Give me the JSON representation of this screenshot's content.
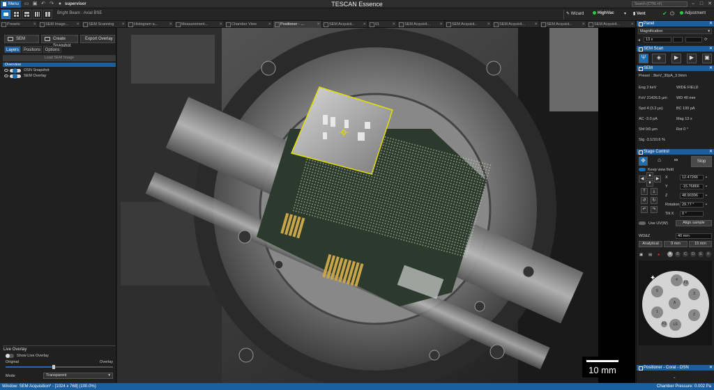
{
  "app": {
    "title": "TESCAN Essence",
    "menu_label": "Menu",
    "user": "supervisor",
    "beam": "Bright Beam : Axial BSE"
  },
  "toolbar": {
    "wizard": "Wizard",
    "vacuum": "HighVac",
    "vent": "Vent",
    "adjustment": "Adjustment",
    "search_placeholder": "Search (CTRL+F)"
  },
  "tabs": [
    {
      "label": "Presets",
      "active": false
    },
    {
      "label": "SEM Image...",
      "active": false
    },
    {
      "label": "SEM Scanning",
      "active": false
    },
    {
      "label": "Histogram a...",
      "active": false
    },
    {
      "label": "Measurement...",
      "active": false
    },
    {
      "label": "Chamber View",
      "active": false
    },
    {
      "label": "Positioner - ...",
      "active": true
    },
    {
      "label": "SEM Acquisit...",
      "active": false
    },
    {
      "label": "01",
      "active": false
    },
    {
      "label": "SEM Acquisit...",
      "active": false
    },
    {
      "label": "SEM Acquisit...",
      "active": false
    },
    {
      "label": "SEM Acquisit...",
      "active": false
    },
    {
      "label": "SEM Acquisit...",
      "active": false
    },
    {
      "label": "SEM Acquisit...",
      "active": false
    }
  ],
  "left": {
    "buttons": [
      "SEM",
      "Create Snapshot",
      "Export Overlay"
    ],
    "subtabs": [
      "Layers",
      "Positions",
      "Options"
    ],
    "load_sem": "Load SEM Image",
    "tree_root": "Overview",
    "layers": [
      "OSN Snapshot",
      "SEM Overlay"
    ],
    "live_overlay": {
      "title": "Live Overlay",
      "show_label": "Show Live Overlay",
      "original": "Original",
      "overlay": "Overlay",
      "mode_label": "Mode",
      "mode_value": "Transparent",
      "slider_fraction": 0.45
    }
  },
  "viewer": {
    "scale_label": "10 mm"
  },
  "right": {
    "panel": {
      "title": "Panel",
      "select_label": "Magnification",
      "value": "13 x"
    },
    "sem_scan": {
      "title": "SEM Scan"
    },
    "sem": {
      "title": "SEM",
      "preset": "Preset : 3keV_30pA_3.9mm",
      "params": [
        {
          "left": "Eng 2 keV",
          "right": "WIDE FIELD"
        },
        {
          "left": "FoV 21426.5 µm",
          "right": "WD 40 mm"
        },
        {
          "left": "Spd 4 (3.2 µs)",
          "right": "BC 100 pA"
        },
        {
          "left": "AC -3.0 pA",
          "right": "Mag 13 x"
        },
        {
          "left": "Shf 0/0 µm",
          "right": "Rot 0 °"
        },
        {
          "left": "Stg -3.1/10.6 %",
          "right": ""
        }
      ]
    },
    "stage": {
      "title": "Stage Control",
      "stop": "Stop",
      "keep_view": "Keep view field",
      "coords": [
        {
          "axis": "X",
          "value": "12.47266"
        },
        {
          "axis": "Y",
          "value": "-15.76866"
        },
        {
          "axis": "Z",
          "value": "48.90396"
        },
        {
          "axis": "Rotation",
          "value": "29.77 °"
        },
        {
          "axis": "Tilt X",
          "value": "0 °"
        }
      ],
      "use_uw": "Use UV(W)",
      "align": "Align sample",
      "wdz_label": "WD&Z",
      "wdz_value": "40 mm",
      "presets": [
        "Analytical",
        "9 mm",
        "15 mm"
      ],
      "slots": [
        "A",
        "B",
        "C",
        "D",
        "E",
        "F"
      ],
      "holder": [
        "4",
        "F2",
        "5",
        "3",
        "A",
        "1",
        "F1",
        "LS",
        "2"
      ]
    },
    "positioner": {
      "title": "Positioner - Coral - OSN"
    }
  },
  "status": {
    "left": "Window: SEM Acquisition* - [1024 x 768] (100.0%)",
    "right_label": "Chamber Pressure:",
    "right_value": "0.002 Pa"
  }
}
